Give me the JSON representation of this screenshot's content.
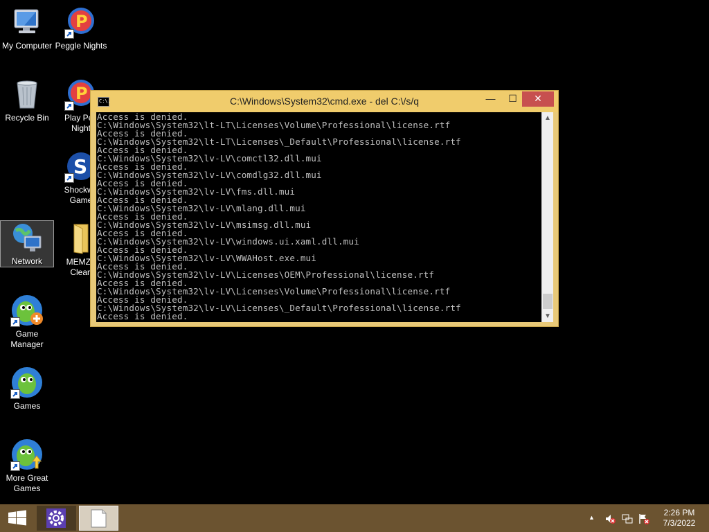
{
  "desktop": {
    "icons": [
      {
        "label": "My Computer"
      },
      {
        "label": "Peggle Nights"
      },
      {
        "label": "Recycle Bin"
      },
      {
        "label": "Play Peg",
        "label2": "Night"
      },
      {
        "label": "Shockwa",
        "label2": "Game"
      },
      {
        "label": "Network"
      },
      {
        "label": "MEMZ -",
        "label2": "Clean"
      },
      {
        "label": "Game",
        "label2": "Manager"
      },
      {
        "label": "Games"
      },
      {
        "label": "More Great",
        "label2": "Games"
      }
    ]
  },
  "cmd": {
    "title": "C:\\Windows\\System32\\cmd.exe - del  C:\\/s/q",
    "icon_text": "C:\\.",
    "minimize": "—",
    "maximize": "☐",
    "close": "✕",
    "lines": [
      "Access is denied.",
      "C:\\Windows\\System32\\lt-LT\\Licenses\\Volume\\Professional\\license.rtf",
      "Access is denied.",
      "C:\\Windows\\System32\\lt-LT\\Licenses\\_Default\\Professional\\license.rtf",
      "Access is denied.",
      "C:\\Windows\\System32\\lv-LV\\comctl32.dll.mui",
      "Access is denied.",
      "C:\\Windows\\System32\\lv-LV\\comdlg32.dll.mui",
      "Access is denied.",
      "C:\\Windows\\System32\\lv-LV\\fms.dll.mui",
      "Access is denied.",
      "C:\\Windows\\System32\\lv-LV\\mlang.dll.mui",
      "Access is denied.",
      "C:\\Windows\\System32\\lv-LV\\msimsg.dll.mui",
      "Access is denied.",
      "C:\\Windows\\System32\\lv-LV\\windows.ui.xaml.dll.mui",
      "Access is denied.",
      "C:\\Windows\\System32\\lv-LV\\WWAHost.exe.mui",
      "Access is denied.",
      "C:\\Windows\\System32\\lv-LV\\Licenses\\OEM\\Professional\\license.rtf",
      "Access is denied.",
      "C:\\Windows\\System32\\lv-LV\\Licenses\\Volume\\Professional\\license.rtf",
      "Access is denied.",
      "C:\\Windows\\System32\\lv-LV\\Licenses\\_Default\\Professional\\license.rtf",
      "Access is denied."
    ]
  },
  "taskbar": {
    "time": "2:26 PM",
    "date": "7/3/2022"
  },
  "colors": {
    "taskbar": "#6b5330",
    "cmd_frame": "#f0cc6c",
    "close_button": "#c7504f"
  }
}
